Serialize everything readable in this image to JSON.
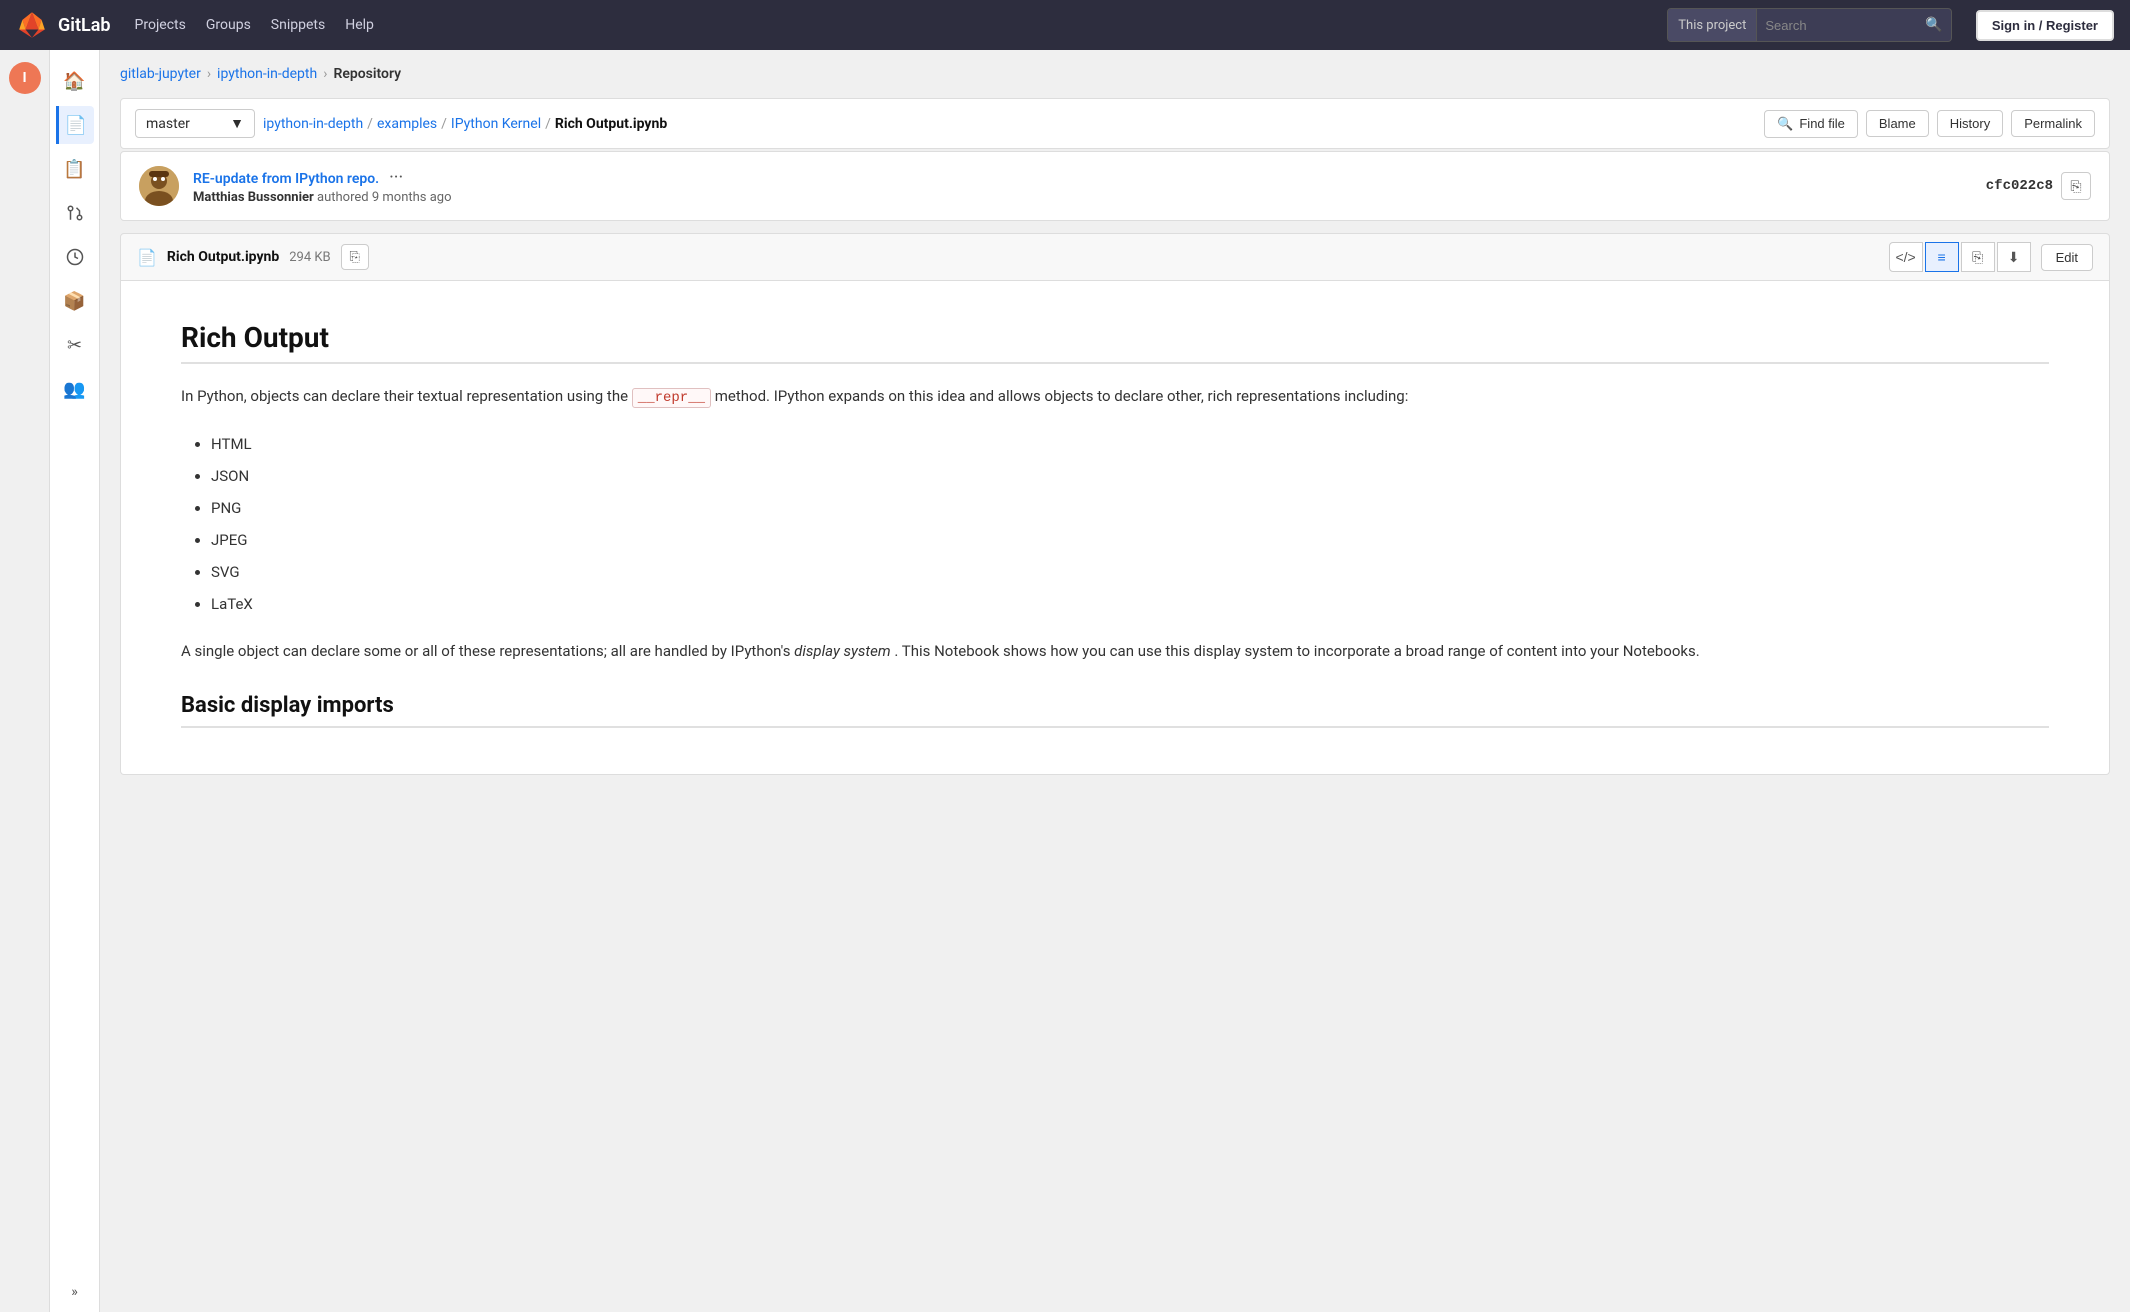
{
  "topnav": {
    "brand": "GitLab",
    "links": [
      "Projects",
      "Groups",
      "Snippets",
      "Help"
    ],
    "search_scope": "This project",
    "search_placeholder": "Search",
    "search_icon": "🔍",
    "signin_label": "Sign in / Register"
  },
  "breadcrumb": {
    "items": [
      "gitlab-jupyter",
      "ipython-in-depth",
      "Repository"
    ]
  },
  "ref": {
    "branch": "master",
    "path_parts": [
      "ipython-in-depth",
      "examples",
      "IPython Kernel",
      "Rich Output.ipynb"
    ],
    "find_file_label": "Find file",
    "blame_label": "Blame",
    "history_label": "History",
    "permalink_label": "Permalink"
  },
  "commit": {
    "message": "RE-update from IPython repo.",
    "dots": "···",
    "author": "Matthias Bussonnier",
    "time": "9 months ago",
    "hash": "cfc022c8"
  },
  "file": {
    "icon": "📄",
    "name": "Rich Output.ipynb",
    "size": "294 KB",
    "edit_label": "Edit"
  },
  "notebook": {
    "title": "Rich Output",
    "intro": "In Python, objects can declare their textual representation using the",
    "repr_code": "__repr__",
    "intro_cont": "method. IPython expands on this idea and allows objects to declare other, rich representations including:",
    "list_items": [
      "HTML",
      "JSON",
      "PNG",
      "JPEG",
      "SVG",
      "LaTeX"
    ],
    "para2_pre": "A single object can declare some or all of these representations; all are handled by IPython's ",
    "para2_italic": "display system",
    "para2_post": ". This Notebook shows how you can use this display system to incorporate a broad range of content into your Notebooks.",
    "section2_title": "Basic display imports"
  },
  "sidebar_icons": [
    {
      "name": "home-icon",
      "symbol": "🏠",
      "active": false
    },
    {
      "name": "repository-icon",
      "symbol": "📄",
      "active": true
    },
    {
      "name": "issues-icon",
      "symbol": "📋",
      "active": false
    },
    {
      "name": "merge-requests-icon",
      "symbol": "🔀",
      "active": false
    },
    {
      "name": "pipelines-icon",
      "symbol": "⏱",
      "active": false
    },
    {
      "name": "packages-icon",
      "symbol": "📦",
      "active": false
    },
    {
      "name": "snippets-icon",
      "symbol": "✂",
      "active": false
    },
    {
      "name": "members-icon",
      "symbol": "👥",
      "active": false
    }
  ]
}
